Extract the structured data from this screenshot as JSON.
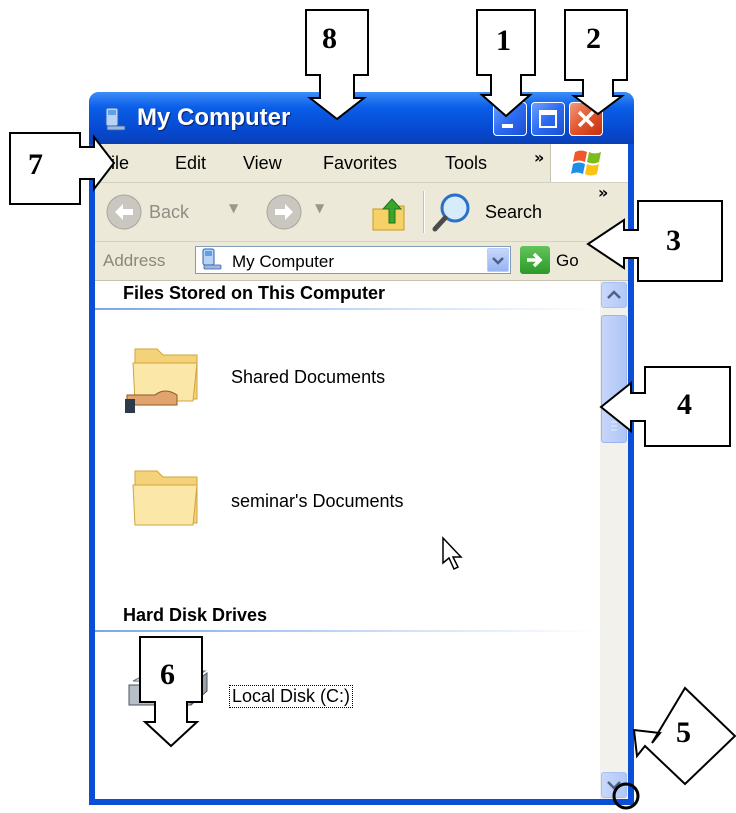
{
  "window": {
    "title": "My Computer"
  },
  "menubar": {
    "items": [
      "File",
      "Edit",
      "View",
      "Favorites",
      "Tools"
    ],
    "overflow": "»"
  },
  "toolbar": {
    "back_label": "Back",
    "search_label": "Search",
    "overflow": "»"
  },
  "addressbar": {
    "label": "Address",
    "value": "My Computer",
    "go_label": "Go"
  },
  "content": {
    "sections": [
      {
        "heading": "Files Stored on This Computer",
        "items": [
          "Shared Documents",
          "seminar's Documents"
        ]
      },
      {
        "heading": "Hard Disk Drives",
        "items": [
          "Local Disk (C:)"
        ]
      }
    ]
  },
  "callouts": [
    "1",
    "2",
    "3",
    "4",
    "5",
    "6",
    "7",
    "8"
  ],
  "colors": {
    "title_bar": "#0a5ee8",
    "window_frame": "#0a4fd6",
    "chrome": "#ece9d8",
    "close_button": "#e2542d"
  }
}
